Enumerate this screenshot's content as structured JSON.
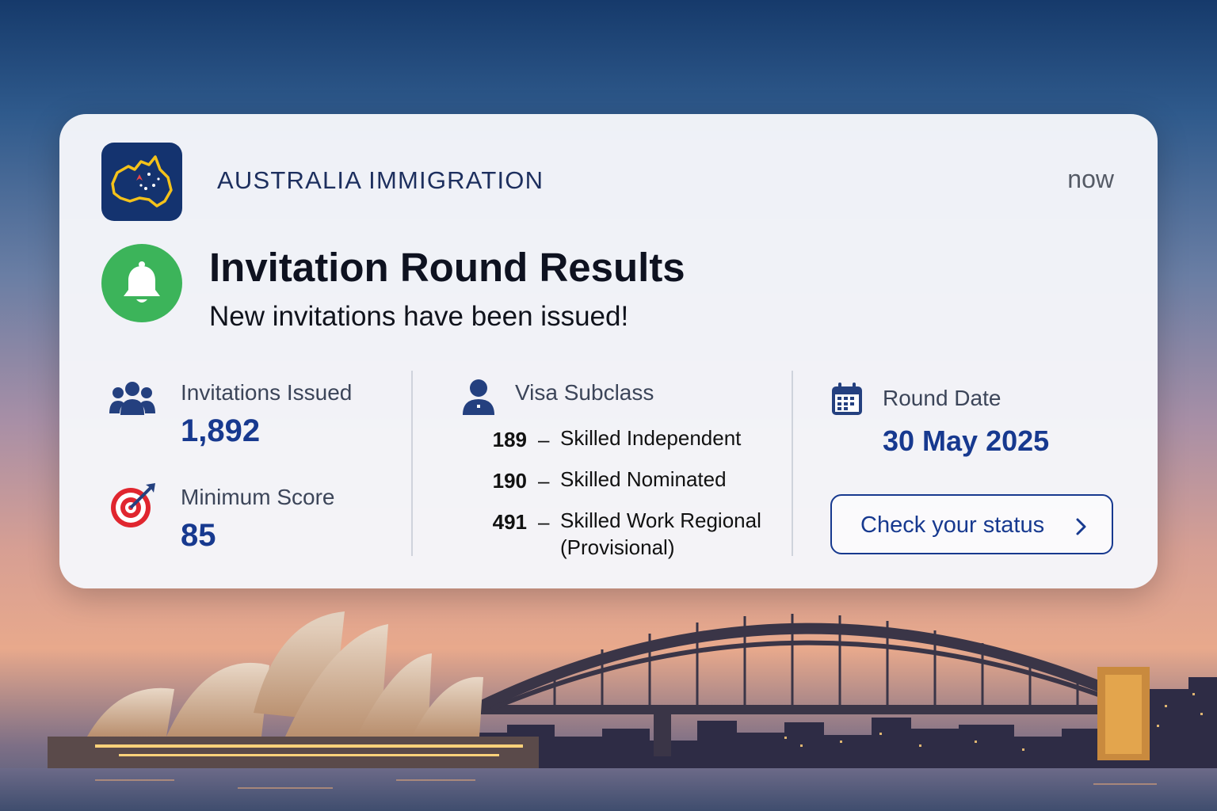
{
  "notification": {
    "app_name": "AUSTRALIA IMMIGRATION",
    "timestamp": "now",
    "app_icon": "australia-map-icon",
    "status_icon": "bell-icon",
    "title": "Invitation Round Results",
    "subtitle": "New invitations have been issued!"
  },
  "stats": {
    "invitations": {
      "label": "Invitations Issued",
      "value": "1,892",
      "icon": "people-icon"
    },
    "min_score": {
      "label": "Minimum Score",
      "value": "85",
      "icon": "target-icon"
    },
    "visa": {
      "label": "Visa Subclass",
      "icon": "person-icon",
      "items": [
        {
          "code": "189",
          "dash": "–",
          "name": "Skilled Independent"
        },
        {
          "code": "190",
          "dash": "–",
          "name": "Skilled Nominated"
        },
        {
          "code": "491",
          "dash": "–",
          "name": "Skilled Work Regional (Provisional)"
        }
      ]
    },
    "round_date": {
      "label": "Round Date",
      "value": "30 May 2025",
      "icon": "calendar-icon"
    }
  },
  "cta": {
    "label": "Check your status",
    "icon": "chevron-right-icon"
  },
  "colors": {
    "accent": "#17398f",
    "app_icon_bg": "#14336f",
    "bell_bg": "#3cb45a",
    "target_red": "#e0262f"
  }
}
